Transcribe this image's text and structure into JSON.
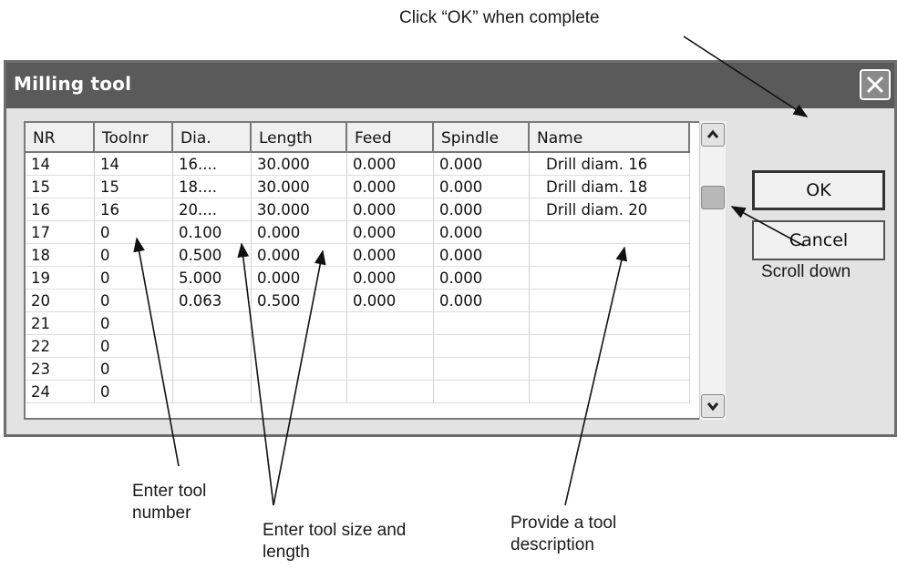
{
  "window": {
    "title": "Milling tool",
    "close_icon": "close-icon"
  },
  "table": {
    "columns": [
      "NR",
      "Toolnr",
      "Dia.",
      "Length",
      "Feed",
      "Spindle",
      "Name"
    ],
    "rows": [
      [
        "14",
        "14",
        "16....",
        "30.000",
        "0.000",
        "0.000",
        "Drill diam. 16"
      ],
      [
        "15",
        "15",
        "18....",
        "30.000",
        "0.000",
        "0.000",
        "Drill diam. 18"
      ],
      [
        "16",
        "16",
        "20....",
        "30.000",
        "0.000",
        "0.000",
        "Drill diam. 20"
      ],
      [
        "17",
        "0",
        "0.100",
        "0.000",
        "0.000",
        "0.000",
        ""
      ],
      [
        "18",
        "0",
        "0.500",
        "0.000",
        "0.000",
        "0.000",
        ""
      ],
      [
        "19",
        "0",
        "5.000",
        "0.000",
        "0.000",
        "0.000",
        ""
      ],
      [
        "20",
        "0",
        "0.063",
        "0.500",
        "0.000",
        "0.000",
        ""
      ],
      [
        "21",
        "0",
        "",
        "",
        "",
        "",
        ""
      ],
      [
        "22",
        "0",
        "",
        "",
        "",
        "",
        ""
      ],
      [
        "23",
        "0",
        "",
        "",
        "",
        "",
        ""
      ],
      [
        "24",
        "0",
        "",
        "",
        "",
        "",
        ""
      ]
    ]
  },
  "buttons": {
    "ok": "OK",
    "cancel": "Cancel"
  },
  "annotations": {
    "ok": "Click “OK” when complete",
    "scroll": "Scroll  down",
    "toolnr_line1": "Enter tool",
    "toolnr_line2": "number",
    "size_line1": "Enter tool size and",
    "size_line2": "length",
    "desc_line1": "Provide a tool",
    "desc_line2": "description"
  },
  "icons": {
    "scroll_up": "chevron-up-icon",
    "scroll_down": "chevron-down-icon"
  }
}
